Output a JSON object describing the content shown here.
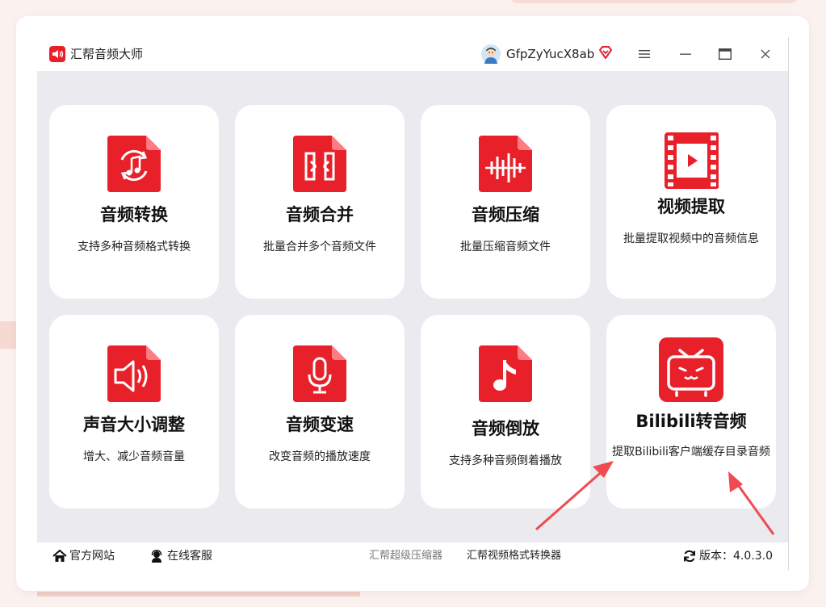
{
  "app": {
    "title": "汇帮音频大师",
    "username": "GfpZyYucX8ab"
  },
  "window_controls": {
    "menu": "menu-icon",
    "minimize": "minimize-icon",
    "maximize": "maximize-icon",
    "close": "close-icon"
  },
  "cards": [
    {
      "title": "音频转换",
      "desc": "支持多种音频格式转换",
      "icon": "audio-convert-icon"
    },
    {
      "title": "音频合并",
      "desc": "批量合并多个音频文件",
      "icon": "audio-merge-icon"
    },
    {
      "title": "音频压缩",
      "desc": "批量压缩音频文件",
      "icon": "audio-compress-icon"
    },
    {
      "title": "视频提取",
      "desc": "批量提取视频中的音频信息",
      "icon": "video-extract-icon"
    },
    {
      "title": "声音大小调整",
      "desc": "增大、减少音频音量",
      "icon": "volume-adjust-icon"
    },
    {
      "title": "音频变速",
      "desc": "改变音频的播放速度",
      "icon": "microphone-icon"
    },
    {
      "title": "音频倒放",
      "desc": "支持多种音频倒着播放",
      "icon": "music-note-icon"
    },
    {
      "title": "Bilibili转音频",
      "desc": "提取Bilibili客户端缓存目录音频",
      "icon": "bilibili-tv-icon"
    }
  ],
  "statusbar": {
    "website": "官方网站",
    "support": "在线客服",
    "link1": "汇帮超级压缩器",
    "link2": "汇帮视频格式转换器",
    "version_label": "版本：",
    "version": "4.0.3.0"
  },
  "colors": {
    "accent": "#e8202a",
    "content_bg": "#eaeaef",
    "arrow": "#ef4b50"
  }
}
